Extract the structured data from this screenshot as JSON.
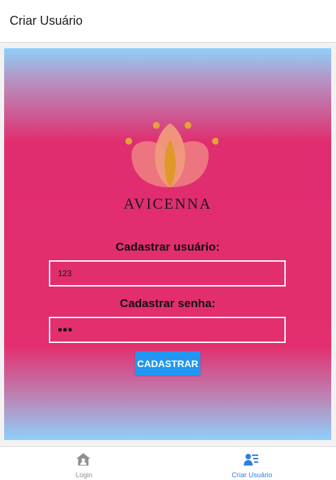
{
  "header": {
    "title": "Criar Usuário"
  },
  "brand": {
    "name": "AVICENNA"
  },
  "form": {
    "user_label": "Cadastrar usuário:",
    "user_value": "123",
    "password_label": "Cadastrar senha:",
    "password_value": "•••",
    "submit_label": "CADASTRAR"
  },
  "tabs": [
    {
      "label": "Login",
      "icon": "home-icon",
      "active": false
    },
    {
      "label": "Criar Usuário",
      "icon": "add-user-icon",
      "active": true
    }
  ],
  "colors": {
    "background_main": "#e32e6f",
    "gradient_edge": "#8fd0fb",
    "button": "#2196f3",
    "active_tab": "#2f7de1",
    "inactive_tab": "#8e8e93"
  }
}
